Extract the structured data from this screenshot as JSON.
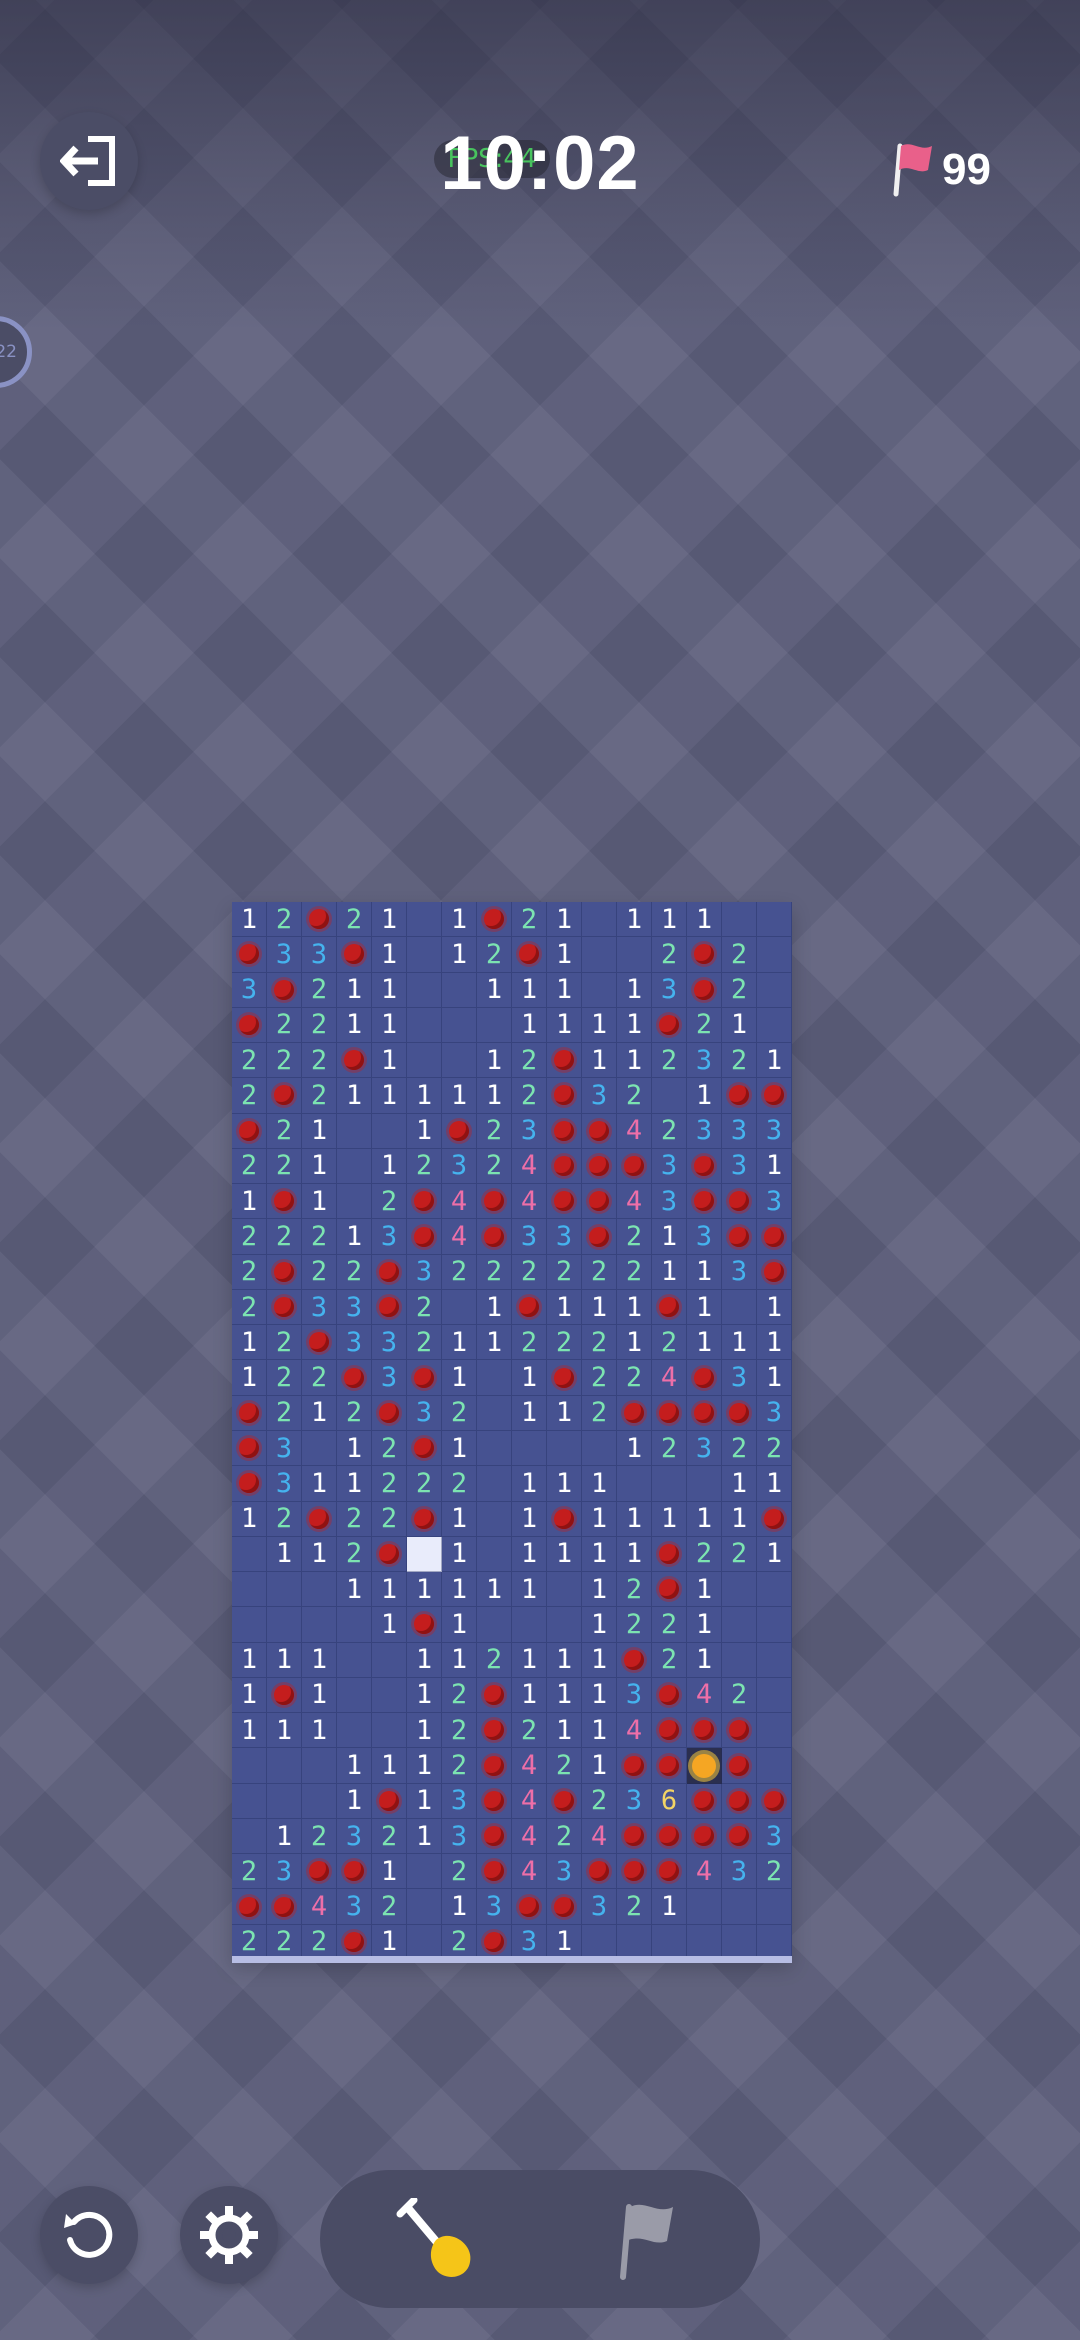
{
  "header": {
    "timer": "10:02",
    "fps": "FPS:44",
    "flags_remaining": "99",
    "side_badge": "22"
  },
  "icons": {
    "exit": "exit-icon",
    "flag": "flag-icon",
    "restart": "restart-icon",
    "settings": "gear-icon",
    "dig": "shovel-icon",
    "flag_tool": "flag-tool-icon"
  },
  "colors": {
    "background": "#5d5f7c",
    "board": "#465291",
    "n1": "#ffffff",
    "n2": "#7ce4b1",
    "n3": "#45b3ee",
    "n4": "#ee6fa8",
    "n6": "#f3d465",
    "mine": "#c41d1d",
    "flag": "#e9608a"
  },
  "board": {
    "cols": 16,
    "rows": 30,
    "legend": "digits = revealed numbers, M = mine, B = exploded mine, S = selected cell, . = empty",
    "grid": [
      "12M21.1M21.111.",
      "M33M1.12M1..2M2",
      "3M211..111.13M2",
      "M2211...1111M21",
      "222M1..12M1123211",
      "2M2111112M32.1MM1",
      "M21..1M23MM423331",
      "221.1232 4MMM3M31",
      "1M1.2M4M4MM43MM3",
      "2221 3M4M33M213MM",
      "2M22M322222211 3M",
      "2M33M2.1M111M1.11",
      "12M3321122212111",
      "122M3M1.1M224M31",
      "M212M32.112MMMM3M",
      "M3.12M1....12 3221",
      "M311222.111...11",
      "12M22M1.1M11111M",
      ".112MS1.1111M221",
      "...111111.12M1",
      "....1M1...1221",
      "111..11211 1M21",
      "1M1..12M11 13M42",
      "111..12M211 4MMM",
      "...1112M421MMBM",
      "...1M13M4M236MMM",
      ".12321 3M424MMMM3",
      "23MM1.2M43MM M4321",
      "MM432.13MM321",
      "222M1.2M31"
    ]
  }
}
